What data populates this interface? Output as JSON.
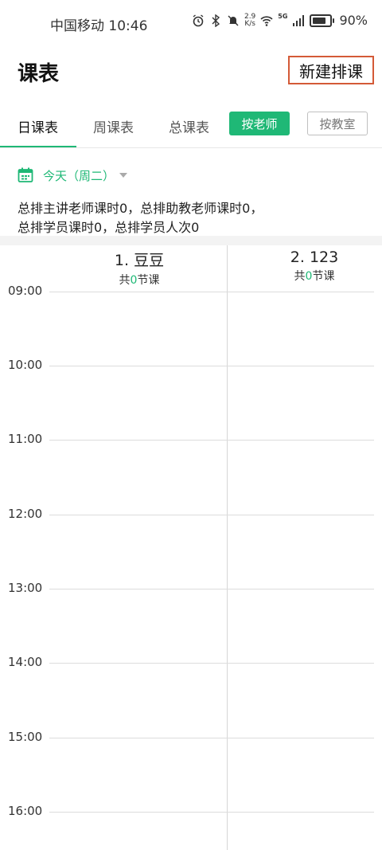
{
  "status_bar": {
    "carrier_time": "中国移动 10:46",
    "speed_value": "2.9",
    "speed_unit": "K/s",
    "network": "5G",
    "battery": "90%"
  },
  "header": {
    "title": "课表",
    "new_button": "新建排课"
  },
  "tabs": [
    {
      "label": "日课表",
      "active": true
    },
    {
      "label": "周课表",
      "active": false
    },
    {
      "label": "总课表",
      "active": false
    }
  ],
  "filters": {
    "by_teacher": "按老师",
    "by_classroom": "按教室"
  },
  "date_selector": {
    "label": "今天（周二）"
  },
  "summary": {
    "line1": "总排主讲老师课时0，总排助教老师课时0，",
    "line2": "总排学员课时0，总排学员人次0"
  },
  "columns": [
    {
      "name": "1. 豆豆",
      "count_prefix": "共",
      "count": "0",
      "count_suffix": "节课"
    },
    {
      "name": "2. 123",
      "count_prefix": "共",
      "count": "0",
      "count_suffix": "节课"
    }
  ],
  "hours": [
    "09:00",
    "10:00",
    "11:00",
    "12:00",
    "13:00",
    "14:00",
    "15:00",
    "16:00"
  ],
  "colors": {
    "accent": "#1fb876",
    "highlight_border": "#d45a37"
  }
}
